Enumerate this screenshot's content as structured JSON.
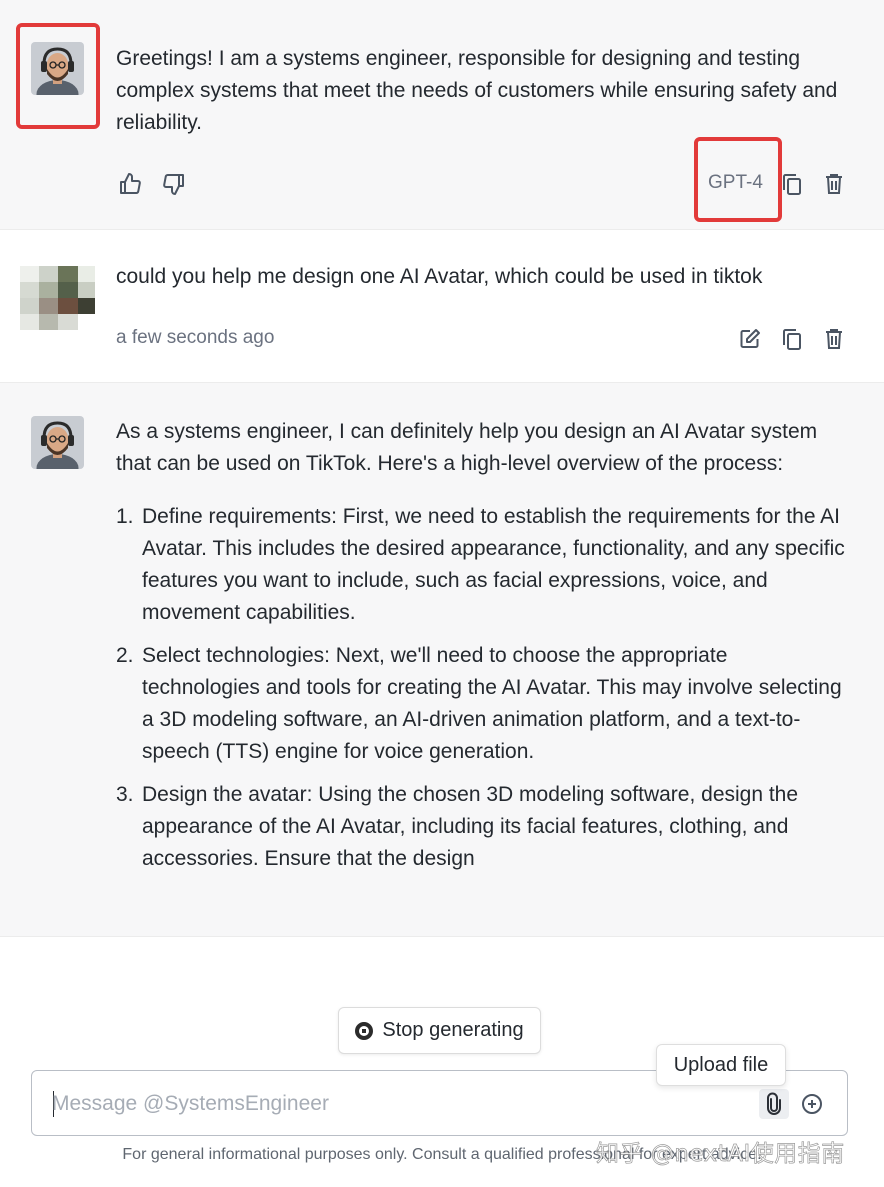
{
  "messages": {
    "first": {
      "text": "Greetings! I am a systems engineer, responsible for designing and testing complex systems that meet the needs of customers while ensuring safety and reliability.",
      "model_label": "GPT-4",
      "icons": [
        "thumbs-up-icon",
        "thumbs-down-icon",
        "copy-icon",
        "trash-icon"
      ]
    },
    "user": {
      "text": "could you help me design one AI Avatar, which could be used in tiktok",
      "timestamp": "a few seconds ago",
      "icons": [
        "edit-icon",
        "copy-icon",
        "trash-icon"
      ]
    },
    "response": {
      "intro": "As a systems engineer, I can definitely help you design an AI Avatar system that can be used on TikTok. Here's a high-level overview of the process:",
      "steps": [
        {
          "num": "1.",
          "text": "Define requirements: First, we need to establish the requirements for the AI Avatar. This includes the desired appearance, functionality, and any specific features you want to include, such as facial expressions, voice, and movement capabilities."
        },
        {
          "num": "2.",
          "text": "Select technologies: Next, we'll need to choose the appropriate technologies and tools for creating the AI Avatar. This may involve selecting a 3D modeling software, an AI-driven animation platform, and a text-to-speech (TTS) engine for voice generation."
        },
        {
          "num": "3.",
          "text": "Design the avatar: Using the chosen 3D modeling software, design the appearance of the AI Avatar, including its facial features, clothing, and accessories. Ensure that the design"
        }
      ]
    }
  },
  "controls": {
    "stop_label": "Stop generating",
    "upload_tooltip": "Upload file",
    "input_placeholder": "Message @SystemsEngineer"
  },
  "footer": {
    "disclaimer": "For general informational purposes only. Consult a qualified professional for expert advice.",
    "watermark": "知乎 @nextAI使用指南"
  },
  "colors": {
    "highlight": "#e23a3a",
    "bot_background": "#f7f7f8",
    "icon": "#4b5563"
  }
}
